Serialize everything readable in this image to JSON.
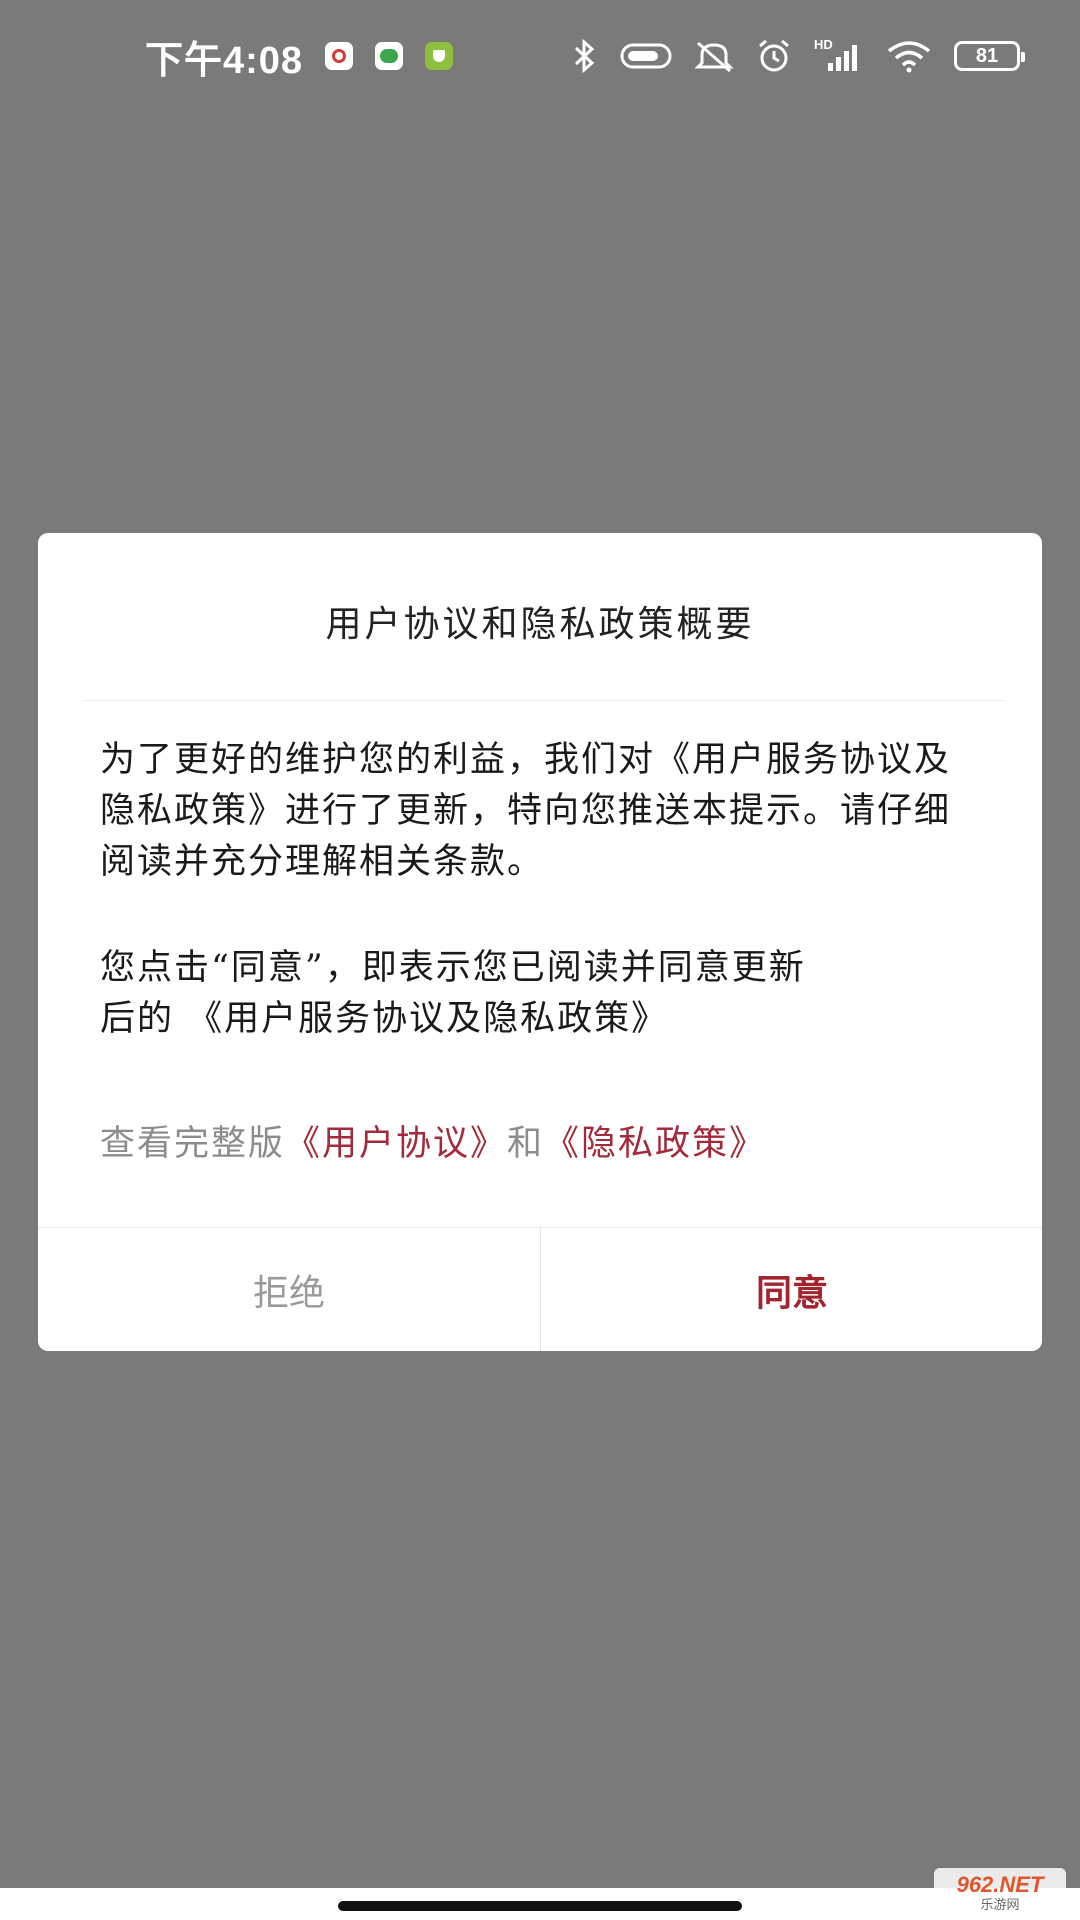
{
  "status_bar": {
    "time": "下午4:08",
    "battery": "81",
    "network_label": "HD",
    "icons": [
      "netease-music-icon",
      "wechat-icon",
      "security-icon",
      "bluetooth-icon",
      "toggle-icon",
      "mute-icon",
      "alarm-icon",
      "signal-icon",
      "wifi-icon",
      "battery-icon"
    ]
  },
  "dialog": {
    "title": "用户协议和隐私政策概要",
    "paragraph1": "为了更好的维护您的利益，我们对《用户服务协议及隐私政策》进行了更新，特向您推送本提示。请仔细阅读并充分理解相关条款。",
    "paragraph2_line1": "您点击“同意”，即表示您已阅读并同意更新",
    "paragraph2_line2": "后的 《用户服务协议及隐私政策》",
    "links": {
      "prefix": "查看完整版",
      "user_agreement": "《用户协议》",
      "and": "和",
      "privacy_policy": "《隐私政策》"
    },
    "reject_label": "拒绝",
    "agree_label": "同意"
  },
  "colors": {
    "overlay": "#7a7a7a",
    "accent": "#a3242f",
    "link": "#a32a3a",
    "muted_text": "#8c8c8c"
  },
  "watermark": {
    "top": "962.NET",
    "bottom": "乐游网"
  }
}
